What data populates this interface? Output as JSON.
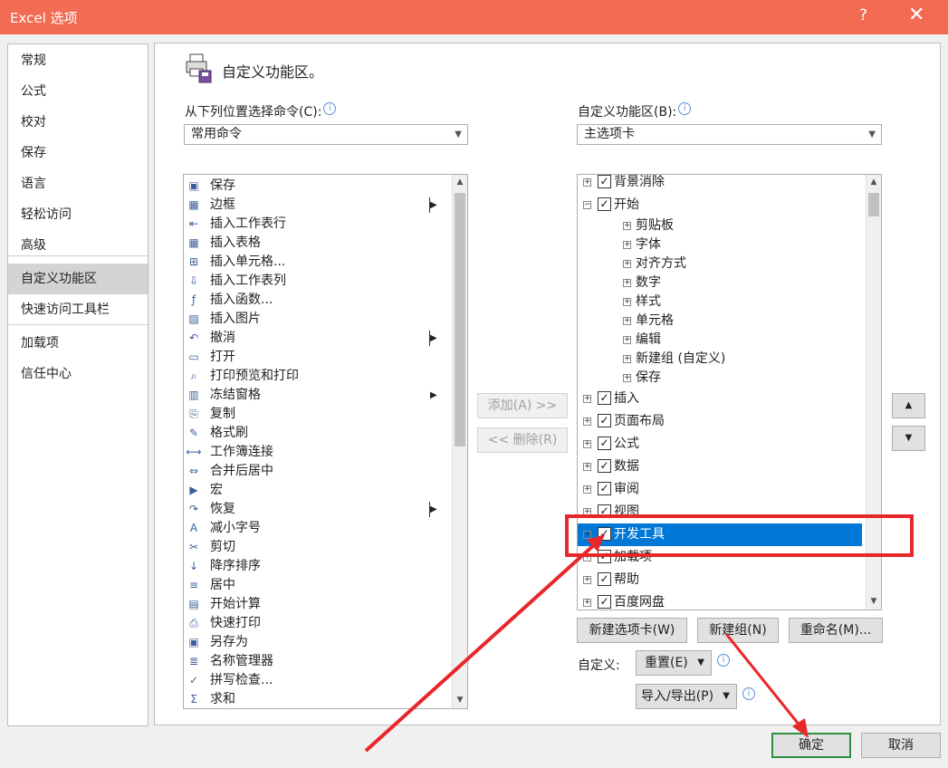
{
  "window": {
    "title": "Excel 选项",
    "help": "?",
    "close": "✕"
  },
  "nav": {
    "items": [
      {
        "label": "常规"
      },
      {
        "label": "公式"
      },
      {
        "label": "校对"
      },
      {
        "label": "保存"
      },
      {
        "label": "语言"
      },
      {
        "label": "轻松访问"
      },
      {
        "label": "高级"
      },
      {
        "label": "自定义功能区"
      },
      {
        "label": "快速访问工具栏"
      },
      {
        "label": "加载项"
      },
      {
        "label": "信任中心"
      }
    ],
    "selected": "自定义功能区"
  },
  "header": {
    "title": "自定义功能区。"
  },
  "left": {
    "label": "从下列位置选择命令(C):",
    "combo_value": "常用命令",
    "commands": [
      {
        "label": "保存",
        "icon": "save-icon"
      },
      {
        "label": "边框",
        "icon": "border-icon",
        "submenu": "split"
      },
      {
        "label": "插入工作表行",
        "icon": "insert-row-icon"
      },
      {
        "label": "插入表格",
        "icon": "table-icon"
      },
      {
        "label": "插入单元格...",
        "icon": "insert-cell-icon"
      },
      {
        "label": "插入工作表列",
        "icon": "insert-column-icon"
      },
      {
        "label": "插入函数...",
        "icon": "function-icon"
      },
      {
        "label": "插入图片",
        "icon": "picture-icon"
      },
      {
        "label": "撤消",
        "icon": "undo-icon",
        "submenu": "split"
      },
      {
        "label": "打开",
        "icon": "folder-icon"
      },
      {
        "label": "打印预览和打印",
        "icon": "print-preview-icon"
      },
      {
        "label": "冻结窗格",
        "icon": "freeze-panes-icon",
        "submenu": "arrow"
      },
      {
        "label": "复制",
        "icon": "copy-icon"
      },
      {
        "label": "格式刷",
        "icon": "format-painter-icon"
      },
      {
        "label": "工作簿连接",
        "icon": "connection-icon"
      },
      {
        "label": "合并后居中",
        "icon": "merge-center-icon"
      },
      {
        "label": "宏",
        "icon": "macro-icon"
      },
      {
        "label": "恢复",
        "icon": "redo-icon",
        "submenu": "split"
      },
      {
        "label": "减小字号",
        "icon": "decrease-font-icon"
      },
      {
        "label": "剪切",
        "icon": "cut-icon"
      },
      {
        "label": "降序排序",
        "icon": "sort-desc-icon"
      },
      {
        "label": "居中",
        "icon": "center-icon"
      },
      {
        "label": "开始计算",
        "icon": "calculator-icon"
      },
      {
        "label": "快速打印",
        "icon": "quick-print-icon"
      },
      {
        "label": "另存为",
        "icon": "save-as-icon"
      },
      {
        "label": "名称管理器",
        "icon": "name-manager-icon"
      },
      {
        "label": "拼写检查...",
        "icon": "spelling-icon"
      },
      {
        "label": "求和",
        "icon": "sum-icon"
      }
    ]
  },
  "middle": {
    "add_label": "添加(A) >>",
    "remove_label": "<< 删除(R)"
  },
  "right": {
    "label": "自定义功能区(B):",
    "combo_value": "主选项卡",
    "tree": [
      {
        "label": "背景消除",
        "level": 0,
        "checked": true,
        "expanded": false
      },
      {
        "label": "开始",
        "level": 0,
        "checked": true,
        "expanded": true
      },
      {
        "label": "剪贴板",
        "level": 1
      },
      {
        "label": "字体",
        "level": 1
      },
      {
        "label": "对齐方式",
        "level": 1
      },
      {
        "label": "数字",
        "level": 1
      },
      {
        "label": "样式",
        "level": 1
      },
      {
        "label": "单元格",
        "level": 1
      },
      {
        "label": "编辑",
        "level": 1
      },
      {
        "label": "新建组 (自定义)",
        "level": 1
      },
      {
        "label": "保存",
        "level": 1
      },
      {
        "label": "插入",
        "level": 0,
        "checked": true
      },
      {
        "label": "页面布局",
        "level": 0,
        "checked": true
      },
      {
        "label": "公式",
        "level": 0,
        "checked": true
      },
      {
        "label": "数据",
        "level": 0,
        "checked": true
      },
      {
        "label": "审阅",
        "level": 0,
        "checked": true
      },
      {
        "label": "视图",
        "level": 0,
        "checked": true
      },
      {
        "label": "开发工具",
        "level": 0,
        "checked": true,
        "selected": true
      },
      {
        "label": "加载项",
        "level": 0,
        "checked": true
      },
      {
        "label": "帮助",
        "level": 0,
        "checked": true
      },
      {
        "label": "百度网盘",
        "level": 0,
        "checked": true
      }
    ],
    "new_tab_label": "新建选项卡(W)",
    "new_group_label": "新建组(N)",
    "rename_label": "重命名(M)...",
    "customize_label": "自定义:",
    "reset_label": "重置(E)",
    "import_export_label": "导入/导出(P)"
  },
  "footer": {
    "ok_label": "确定",
    "cancel_label": "取消"
  },
  "colors": {
    "titlebar": "#f26b53",
    "selection": "#0078d7",
    "highlight": "#e8272b"
  }
}
